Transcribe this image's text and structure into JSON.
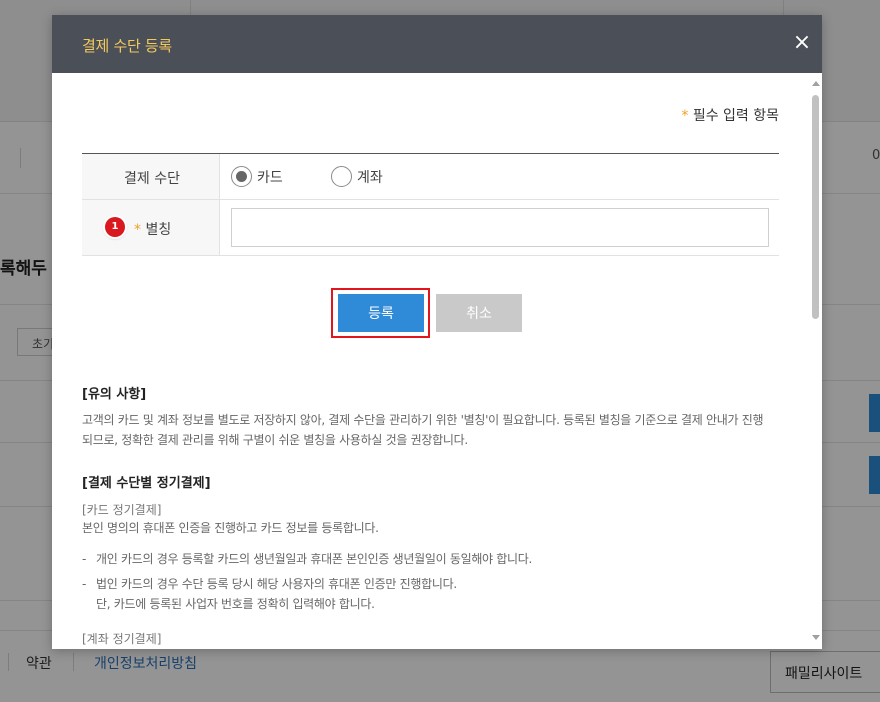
{
  "background": {
    "heading_fragment": "록해두",
    "reset_button_fragment": "초기",
    "row_value_fragment": "0",
    "footer": {
      "terms": "약관",
      "privacy": "개인정보처리방침",
      "family_site": "패밀리사이트"
    }
  },
  "modal": {
    "title": "결제 수단 등록",
    "close_icon": "×",
    "required_star": "*",
    "required_note": "필수 입력 항목",
    "form": {
      "payment_method_label": "결제 수단",
      "options": [
        {
          "label": "카드",
          "checked": true
        },
        {
          "label": "계좌",
          "checked": false
        }
      ],
      "step_badge": "1",
      "alias_star": "*",
      "alias_label": "별칭",
      "alias_value": ""
    },
    "buttons": {
      "register": "등록",
      "cancel": "취소"
    },
    "notice": {
      "title": "[유의 사항]",
      "line1": "고객의 카드 및 계좌 정보를 별도로 저장하지 않아, 결제 수단을 관리하기 위한 '별칭'이 필요합니다. 등록된 별칭을 기준으로 결제 안내가 진행",
      "line2": "되므로, 정확한 결제 관리를 위해 구별이 쉬운 별칭을 사용하실 것을 권장합니다."
    },
    "recurring": {
      "title": "[결제 수단별 정기결제]",
      "card_title": "[카드 정기결제]",
      "card_desc": "본인 명의의 휴대폰 인증을 진행하고 카드 정보를 등록합니다.",
      "bullet_dash": "-",
      "bullet1": "개인 카드의 경우 등록할 카드의 생년월일과 휴대폰 본인인증 생년월일이 동일해야 합니다.",
      "bullet2_line1": "법인 카드의 경우 수단 등록 당시 해당 사용자의 휴대폰 인증만 진행합니다.",
      "bullet2_line2": "단, 카드에 등록된 사업자 번호를 정확히 입력해야 합니다.",
      "account_title": "[계좌 정기결제]"
    }
  },
  "colors": {
    "header_bg": "#4a4f58",
    "title_color": "#f4c95d",
    "primary": "#2f8ad8",
    "highlight": "#e1151b",
    "badge": "#d9191f"
  }
}
